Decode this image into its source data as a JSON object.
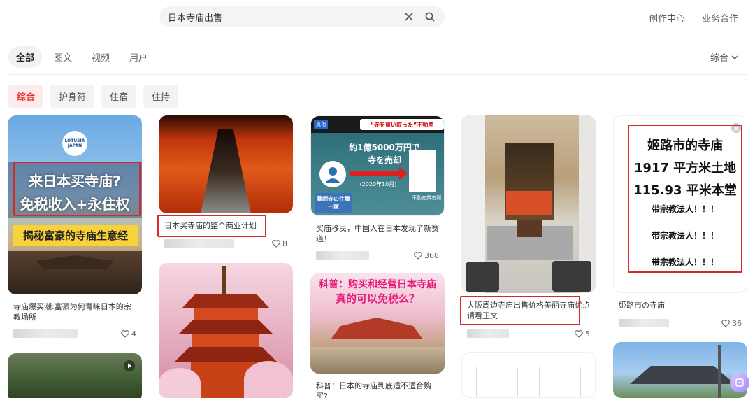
{
  "search": {
    "query": "日本寺庙出售"
  },
  "top_links": [
    "创作中心",
    "业务合作"
  ],
  "main_tabs": [
    "全部",
    "图文",
    "视频",
    "用户"
  ],
  "sort": {
    "label": "综合"
  },
  "filters": [
    "综合",
    "护身符",
    "住宿",
    "住持"
  ],
  "cards": [
    {
      "title": "寺庙爆买潮:富豪为何青睐日本的宗教场所",
      "likes": "4",
      "thumb_text": {
        "logo": "LOTUSIA JAPAN",
        "line1": "来日本买寺庙?",
        "line2": "免税收入+永住权",
        "banner": "揭秘富豪的寺庙生意经"
      }
    },
    {
      "title": "日本买寺庙的整个商业计划",
      "likes": "8"
    },
    {
      "title": "买庙移民，中国人在日本发现了新赛道！",
      "likes": "368",
      "thumb_text": {
        "tag": "真相",
        "header": "“寺を買い取った”不動産",
        "amount": "約1億5000万円で",
        "amount2": "寺を売却",
        "year": "(2020年10月)",
        "left_label": "薬師寺の住職一家",
        "right_label": "不動産業者側"
      }
    },
    {
      "title": "大阪周边寺庙出售价格美丽寺庙优点请看正文",
      "likes": "5"
    },
    {
      "title": "姫路市の寺庙",
      "likes": "36",
      "thumb_text": {
        "line1": "姬路市的寺庙",
        "line2": "1917 平方米土地",
        "line3": "115.93 平米本堂",
        "line4": "带宗教法人！！！",
        "line5": "带宗教法人！！！",
        "line6": "带宗教法人！！！"
      }
    },
    {
      "title": "科普：日本的寺庙到底适不适合购买?",
      "thumb_text": {
        "line1": "科普：购买和经营日本寺庙",
        "line2": "真的可以免税么？"
      }
    }
  ],
  "colors": {
    "accent": "#ee3a3a",
    "highlight_box": "#d42a2a"
  }
}
